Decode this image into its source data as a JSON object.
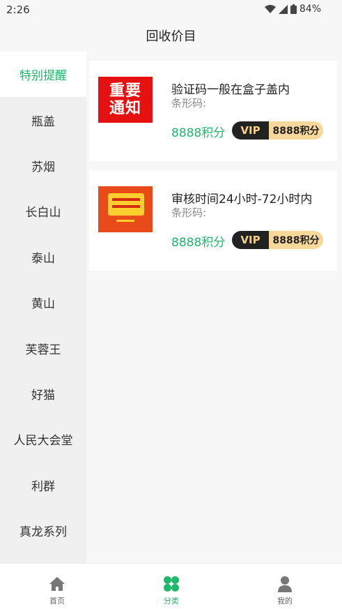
{
  "status_bar": {
    "time": "2:26",
    "battery": "84%"
  },
  "header": {
    "title": "回收价目"
  },
  "sidebar": {
    "items": [
      {
        "label": "特别提醒",
        "active": true
      },
      {
        "label": "瓶盖"
      },
      {
        "label": "苏烟"
      },
      {
        "label": "长白山"
      },
      {
        "label": "泰山"
      },
      {
        "label": "黄山"
      },
      {
        "label": "芙蓉王"
      },
      {
        "label": "好猫"
      },
      {
        "label": "人民大会堂"
      },
      {
        "label": "利群"
      },
      {
        "label": "真龙系列"
      }
    ]
  },
  "cards": [
    {
      "title": "验证码一般在盒子盖内",
      "barcode_label": "条形码:",
      "points": "8888积分",
      "vip_label": "VIP",
      "vip_points": "8888积分",
      "thumb_text": "重要通知"
    },
    {
      "title": "审核时间24小时-72小时内",
      "barcode_label": "条形码:",
      "points": "8888积分",
      "vip_label": "VIP",
      "vip_points": "8888积分"
    }
  ],
  "bottom_nav": {
    "home_label": "首页",
    "category_label": "分类",
    "mine_label": "我的"
  },
  "colors": {
    "accent": "#1fb86a",
    "vip_dark": "#222222",
    "vip_gold": "#f6d99a",
    "notice_red": "#e51111"
  },
  "icons": {
    "home": "home-icon",
    "category": "clover-icon",
    "mine": "user-icon"
  }
}
